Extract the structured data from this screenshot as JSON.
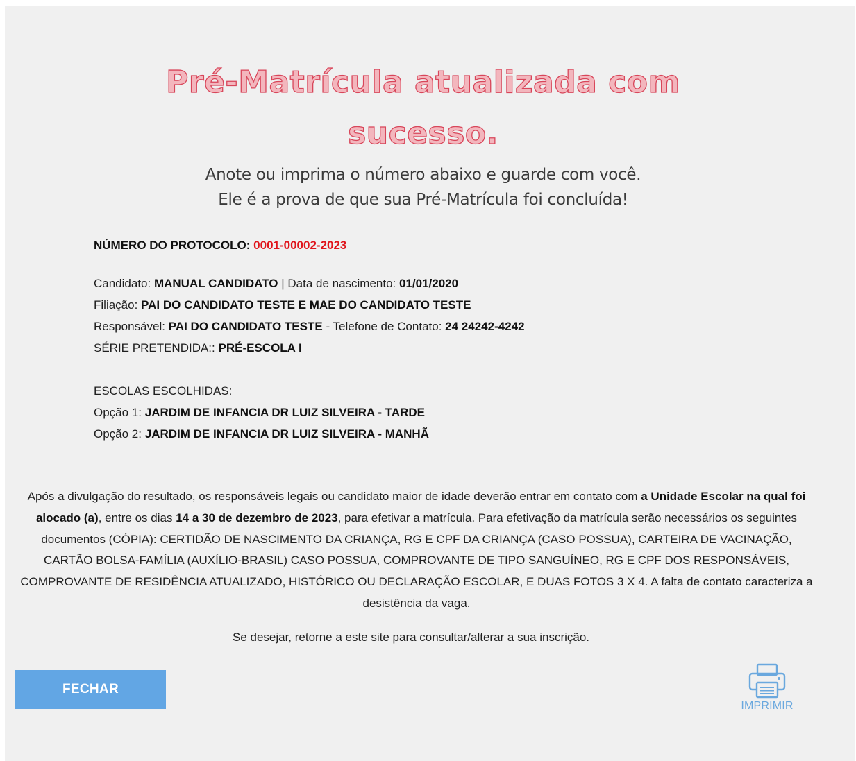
{
  "title": {
    "line1": "Pré-Matrícula atualizada com",
    "line2": "sucesso."
  },
  "subtitle": {
    "line1": "Anote ou imprima o número abaixo e guarde com você.",
    "line2": "Ele é a prova de que sua Pré-Matrícula foi concluída!"
  },
  "protocol": {
    "label": "NÚMERO DO PROTOCOLO:",
    "number": "0001-00002-2023"
  },
  "candidate": {
    "name_label": "Candidato:",
    "name": "MANUAL CANDIDATO",
    "sep": "|",
    "birth_label": "Data de nascimento:",
    "birth": "01/01/2020",
    "filiation_label": "Filiação:",
    "filiation": "PAI DO CANDIDATO TESTE E MAE DO CANDIDATO TESTE",
    "responsible_label": "Responsável:",
    "responsible": "PAI DO CANDIDATO TESTE",
    "phone_label": "- Telefone de Contato:",
    "phone": "24 24242-4242",
    "grade_label": "SÉRIE PRETENDIDA::",
    "grade": "PRÉ-ESCOLA I"
  },
  "schools": {
    "heading": "ESCOLAS ESCOLHIDAS:",
    "options": [
      {
        "label": "Opção 1:",
        "value": "JARDIM DE INFANCIA DR LUIZ SILVEIRA - TARDE"
      },
      {
        "label": "Opção 2:",
        "value": "JARDIM DE INFANCIA DR LUIZ SILVEIRA - MANHÃ"
      }
    ]
  },
  "notice": {
    "part1": "Após a divulgação do resultado, os responsáveis legais ou candidato maior de idade deverão entrar em contato com ",
    "bold1": "a Unidade Escolar na qual foi alocado (a)",
    "part2": ", entre os dias ",
    "bold2": "14 a 30 de dezembro de 2023",
    "part3": ", para efetivar a matrícula. Para efetivação da matrícula serão necessários os seguintes documentos (CÓPIA): CERTIDÃO DE NASCIMENTO DA CRIANÇA, RG E CPF DA CRIANÇA (CASO POSSUA), CARTEIRA DE VACINAÇÃO, CARTÃO BOLSA-FAMÍLIA (AUXÍLIO-BRASIL) CASO POSSUA, COMPROVANTE DE TIPO SANGUÍNEO, RG E CPF DOS RESPONSÁVEIS, COMPROVANTE DE RESIDÊNCIA ATUALIZADO, HISTÓRICO OU DECLARAÇÃO ESCOLAR, E DUAS FOTOS 3 X 4. A falta de contato caracteriza a desistência da vaga."
  },
  "retorne": "Se desejar, retorne a este site para consultar/alterar a sua inscrição.",
  "actions": {
    "close_label": "FECHAR",
    "print_label": "IMPRIMIR",
    "print_icon": "printer-icon"
  },
  "colors": {
    "panel_bg": "#f0f0f0",
    "title_fill": "#f3b6bd",
    "title_stroke": "#d8465a",
    "protocol_number": "#e0141b",
    "button_bg": "#62a6e4",
    "print_accent": "#6aa8de"
  }
}
